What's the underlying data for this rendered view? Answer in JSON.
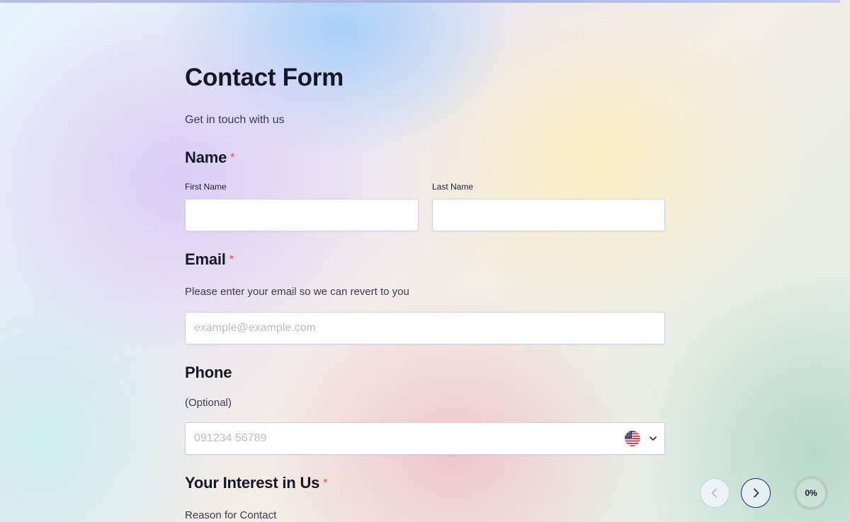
{
  "form": {
    "title": "Contact Form",
    "subtitle": "Get in touch with us"
  },
  "name_section": {
    "label": "Name",
    "required_mark": "*",
    "first_name_label": "First Name",
    "first_name_value": "",
    "last_name_label": "Last Name",
    "last_name_value": ""
  },
  "email_section": {
    "label": "Email",
    "required_mark": "*",
    "description": "Please enter your email so we can revert to you",
    "placeholder": "example@example.com",
    "value": ""
  },
  "phone_section": {
    "label": "Phone",
    "description": "(Optional)",
    "placeholder": "091234 56789",
    "value": "",
    "country_flag_icon": "us-flag-icon",
    "dropdown_icon": "chevron-down-icon"
  },
  "interest_section": {
    "label": "Your Interest in Us",
    "required_mark": "*",
    "description": "Reason for Contact"
  },
  "navigation": {
    "prev_icon": "chevron-left-icon",
    "next_icon": "chevron-right-icon"
  },
  "progress": {
    "value": 0,
    "label": "0%"
  },
  "colors": {
    "accent": "#232a7a",
    "required": "#e2505a",
    "title": "#151728",
    "placeholder": "#b8bccb"
  }
}
